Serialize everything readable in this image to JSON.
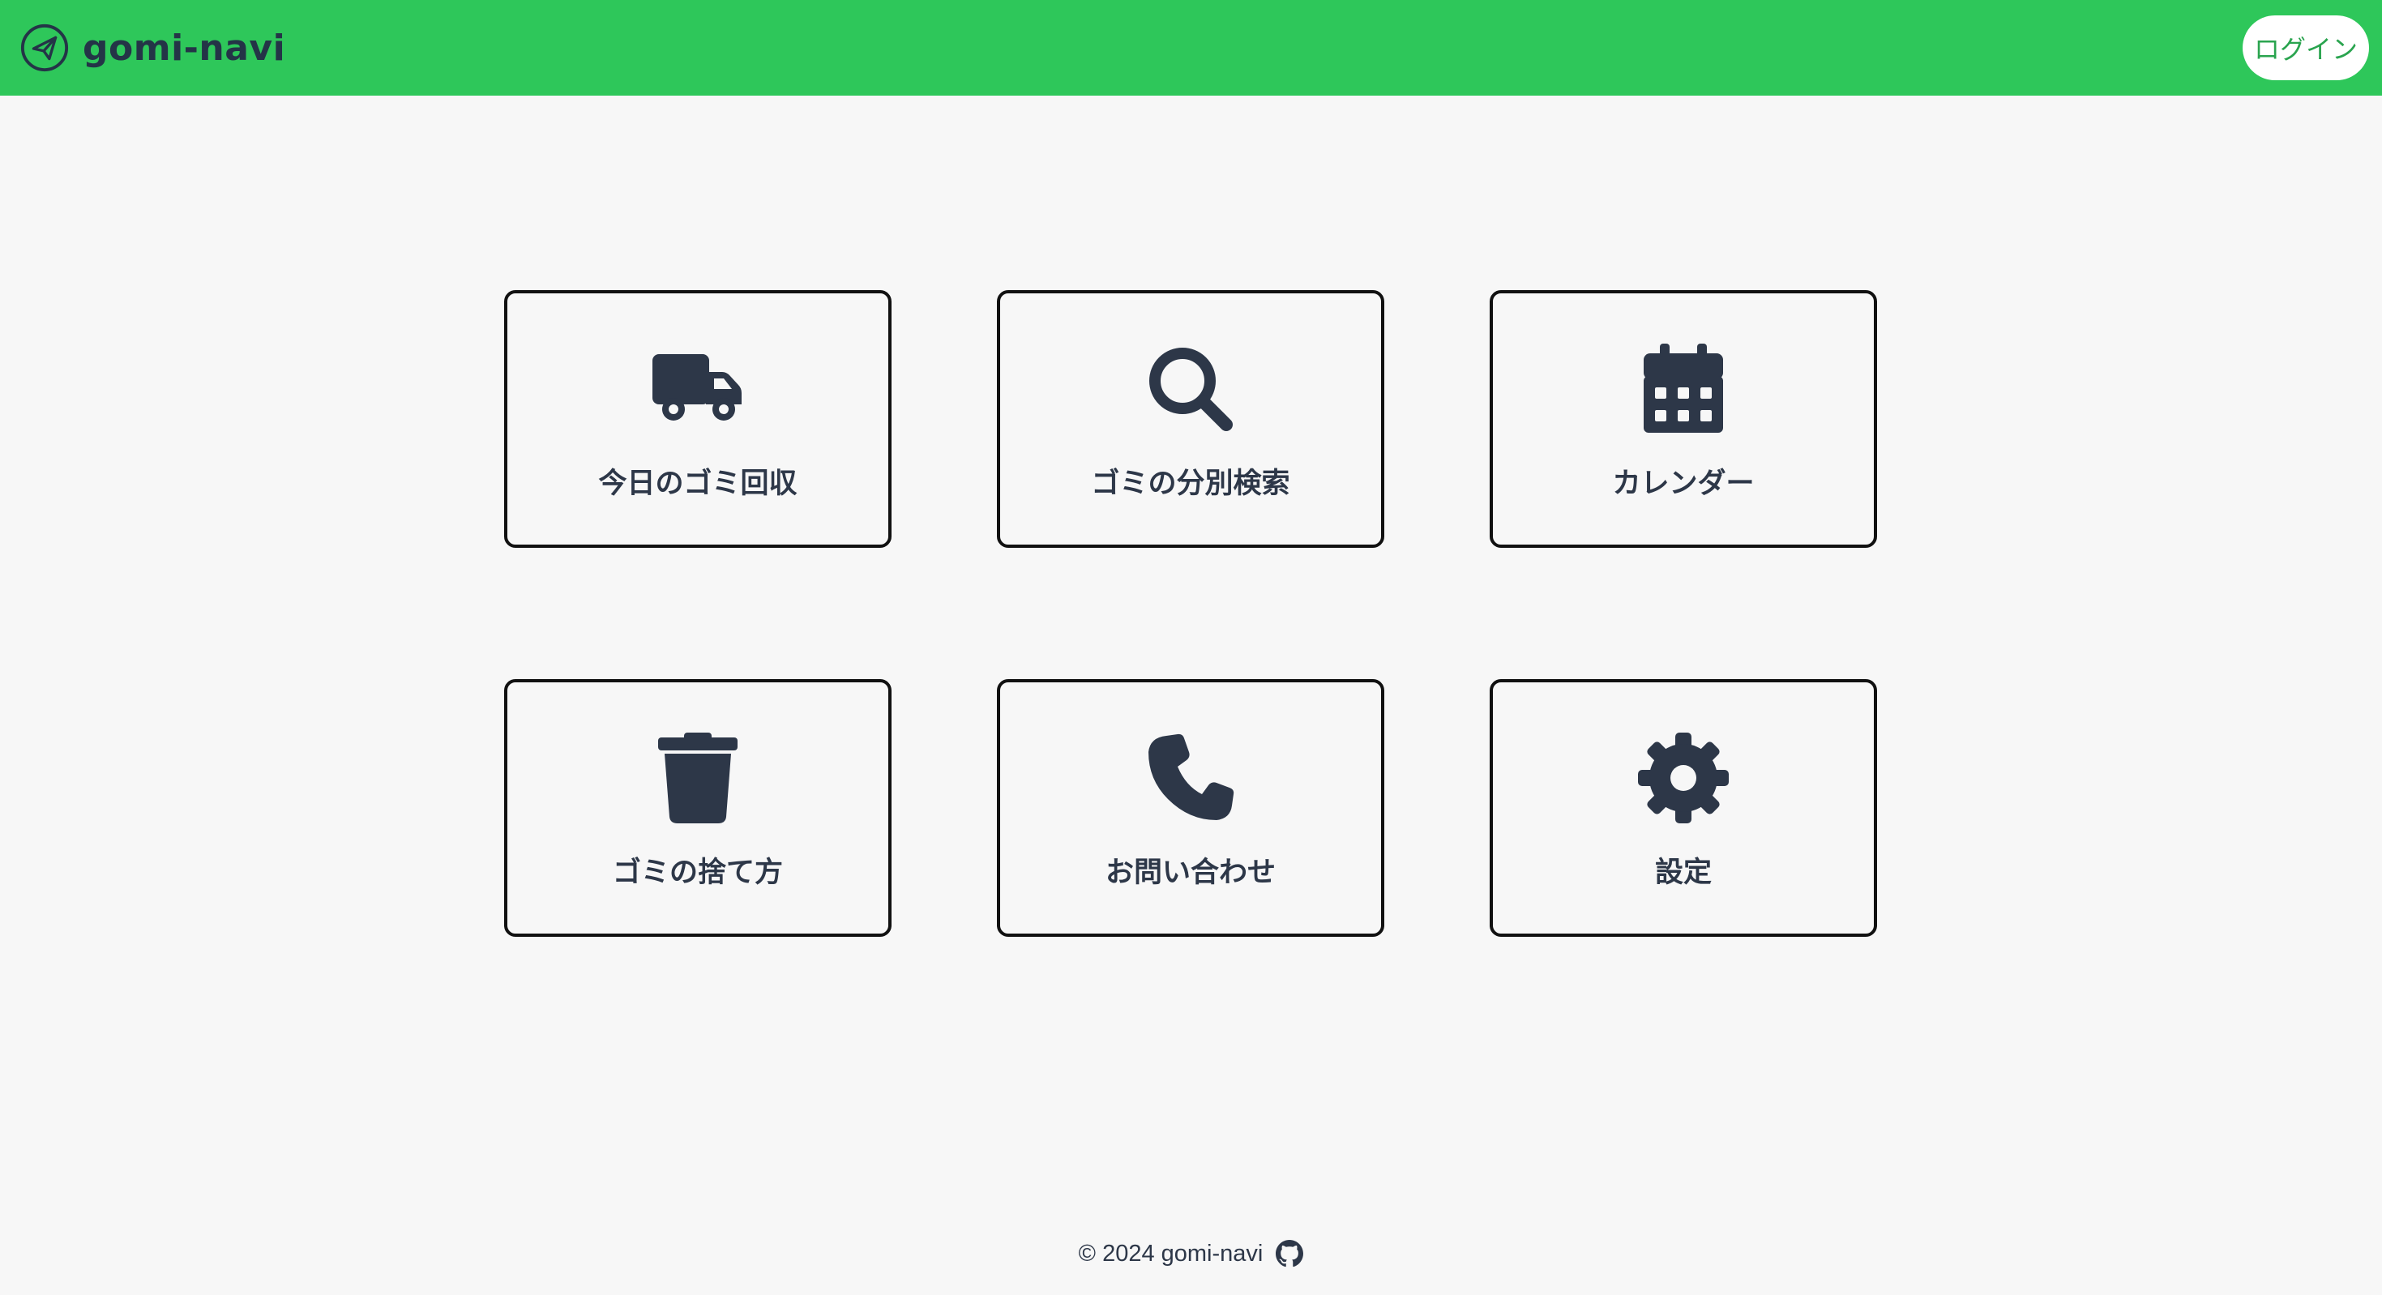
{
  "navbar": {
    "brand_name": "gomi-navi",
    "brand_icon": "paper-plane-icon",
    "login_label": "ログイン",
    "background_color": "#2ec75a"
  },
  "menu": {
    "items": [
      {
        "label": "今日のゴミ回収",
        "icon": "truck-icon"
      },
      {
        "label": "ゴミの分別検索",
        "icon": "magnifying-glass-icon"
      },
      {
        "label": "カレンダー",
        "icon": "calendar-icon"
      },
      {
        "label": "ゴミの捨て方",
        "icon": "trash-can-icon"
      },
      {
        "label": "お問い合わせ",
        "icon": "phone-icon"
      },
      {
        "label": "設定",
        "icon": "gear-icon"
      }
    ]
  },
  "footer": {
    "copyright": "© 2024 gomi-navi",
    "icon": "github-icon"
  },
  "colors": {
    "icon_color": "#2d3748",
    "card_border": "#111111",
    "page_background": "#f7f7f7",
    "login_text": "#2aa44f"
  }
}
